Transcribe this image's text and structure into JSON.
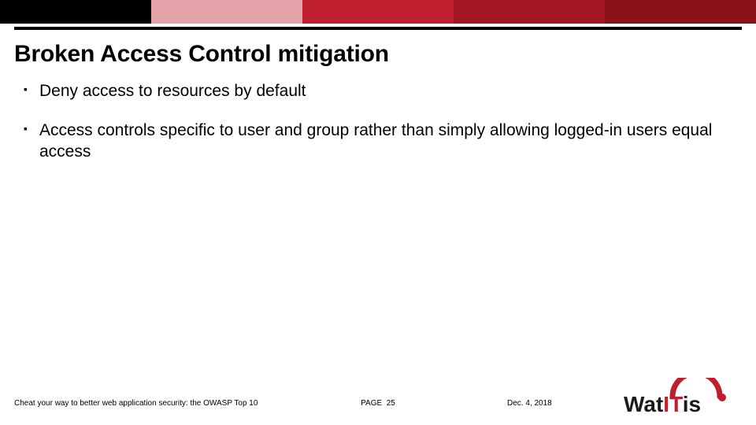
{
  "colors": {
    "topbar": [
      "#000000",
      "#e2a2a8",
      "#be1e2d",
      "#a31723",
      "#8c1219"
    ],
    "logo_red": "#be1e2d",
    "logo_dark": "#1a1a1a"
  },
  "title": "Broken Access Control mitigation",
  "bullets": [
    "Deny access to resources by default",
    "Access controls specific to user and group rather than simply allowing logged-in users equal access"
  ],
  "footer": {
    "left": "Cheat your way to better web application security: the OWASP Top 10",
    "page_label": "PAGE",
    "page_number": "25",
    "date": "Dec. 4, 2018"
  },
  "logo": {
    "text_pre": "Wat",
    "text_bold": "IT",
    "text_post": "is"
  }
}
